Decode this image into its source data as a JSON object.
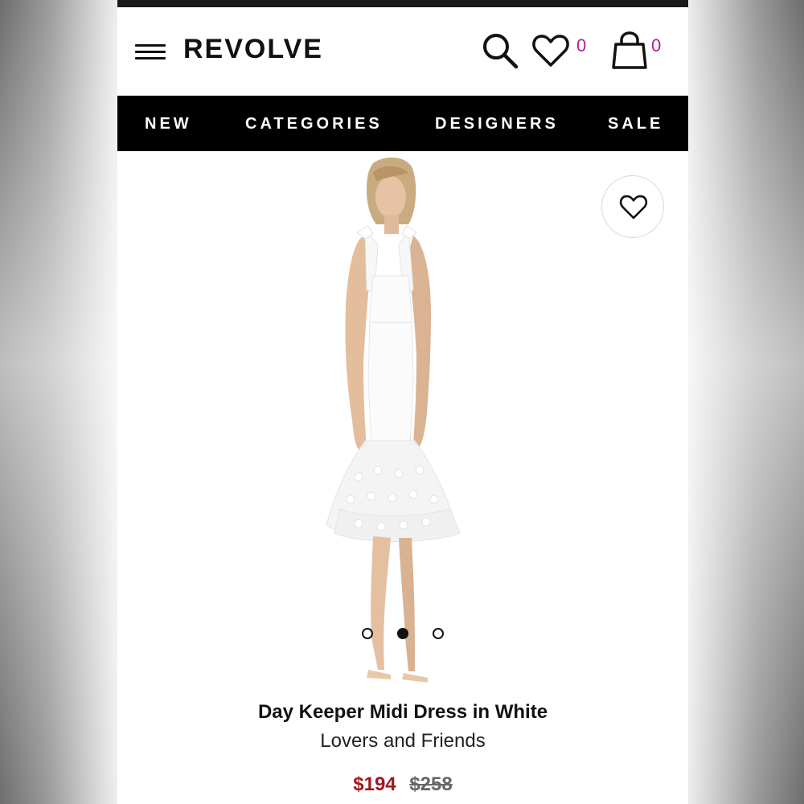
{
  "header": {
    "logo": "REVOLVE",
    "wishlist_count": "0",
    "bag_count": "0",
    "icons": [
      "menu-icon",
      "search-icon",
      "heart-icon",
      "bag-icon"
    ]
  },
  "nav": {
    "items": [
      "NEW",
      "CATEGORIES",
      "DESIGNERS",
      "SALE"
    ]
  },
  "product": {
    "image_alt": "Model wearing white midi dress with polka dot tiered mesh hem",
    "carousel": {
      "total": 3,
      "active_index": 1
    },
    "name": "Day Keeper Midi Dress in White",
    "brand": "Lovers and Friends",
    "price_sale": "$194",
    "price_original": "$258"
  },
  "colors": {
    "accent_count": "#b0208a",
    "sale_price": "#a3161e",
    "nav_bg": "#000000"
  }
}
